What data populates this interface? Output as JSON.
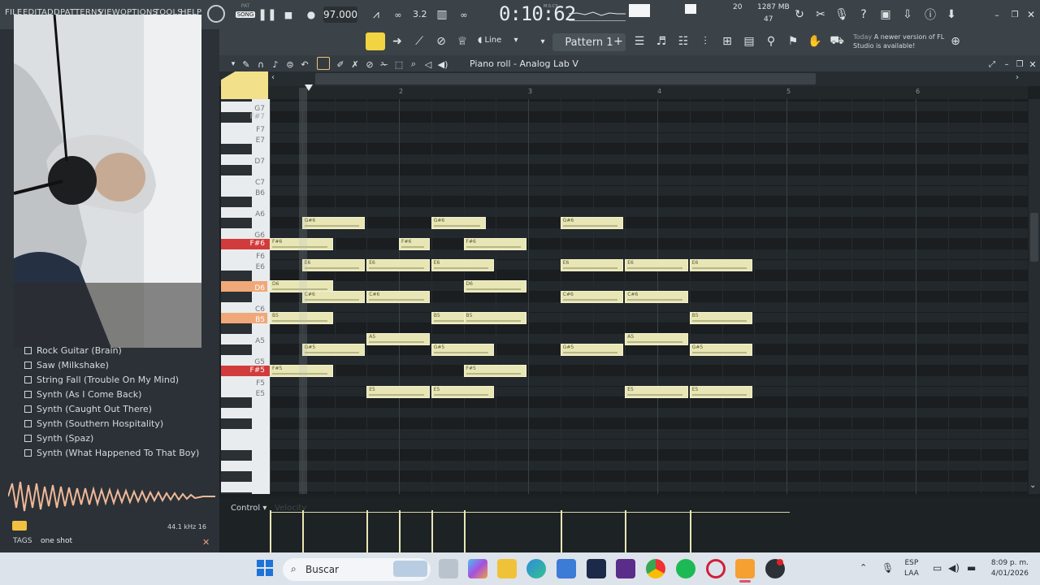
{
  "menu": [
    "FILE",
    "EDIT",
    "ADD",
    "PATTERNS",
    "VIEW",
    "OPTIONS",
    "TOOLS",
    "HELP"
  ],
  "transport": {
    "mode_top": "PAT",
    "mode_bottom": "SONG",
    "tempo": "97.000",
    "time": "0:10:62",
    "time_unit": "M:S:CS",
    "pattern_small": "3.2"
  },
  "stats": {
    "memory": "1287 MB",
    "cpu": "20",
    "polyphony": "47"
  },
  "toolbar": {
    "snap": "Line",
    "pattern": "Pattern 1",
    "news_date": "Today",
    "news_text": "A newer version of FL Studio is available!"
  },
  "piano_roll": {
    "title": "Piano roll - Analog Lab V",
    "bars": [
      "2",
      "3",
      "4",
      "5",
      "6"
    ],
    "keys": [
      "G7",
      "F#7",
      "F7",
      "E7",
      "D7",
      "C7",
      "B6",
      "A6",
      "G6",
      "F#6",
      "F6",
      "E6",
      "D6",
      "C6",
      "B5",
      "A5",
      "G5",
      "F#5",
      "F5",
      "E5"
    ],
    "highlighted_keys": [
      "F#6",
      "D6",
      "B5",
      "F#5"
    ]
  },
  "notes": [
    {
      "p": "G#6",
      "s": 1.5,
      "l": 1
    },
    {
      "p": "G#6",
      "s": 3.5,
      "l": 0.875
    },
    {
      "p": "G#6",
      "s": 5.5,
      "l": 1
    },
    {
      "p": "F#6",
      "s": 1,
      "l": 1
    },
    {
      "p": "F#6",
      "s": 3,
      "l": 0.5
    },
    {
      "p": "F#6",
      "s": 4,
      "l": 1
    },
    {
      "p": "E6",
      "s": 1.5,
      "l": 1
    },
    {
      "p": "E6",
      "s": 2.5,
      "l": 1
    },
    {
      "p": "E6",
      "s": 3.5,
      "l": 1
    },
    {
      "p": "E6",
      "s": 5.5,
      "l": 1
    },
    {
      "p": "E6",
      "s": 6.5,
      "l": 1
    },
    {
      "p": "E6",
      "s": 7.5,
      "l": 1
    },
    {
      "p": "D6",
      "s": 1,
      "l": 1
    },
    {
      "p": "D6",
      "s": 4,
      "l": 1
    },
    {
      "p": "C#6",
      "s": 1.5,
      "l": 1
    },
    {
      "p": "C#6",
      "s": 2.5,
      "l": 1
    },
    {
      "p": "C#6",
      "s": 5.5,
      "l": 1
    },
    {
      "p": "C#6",
      "s": 6.5,
      "l": 1
    },
    {
      "p": "B5",
      "s": 1,
      "l": 1
    },
    {
      "p": "B5",
      "s": 3.5,
      "l": 1
    },
    {
      "p": "B5",
      "s": 4,
      "l": 1
    },
    {
      "p": "B5",
      "s": 7.5,
      "l": 1
    },
    {
      "p": "A5",
      "s": 2.5,
      "l": 1
    },
    {
      "p": "A5",
      "s": 6.5,
      "l": 1
    },
    {
      "p": "G#5",
      "s": 1.5,
      "l": 1
    },
    {
      "p": "G#5",
      "s": 3.5,
      "l": 1
    },
    {
      "p": "G#5",
      "s": 5.5,
      "l": 1
    },
    {
      "p": "G#5",
      "s": 7.5,
      "l": 1
    },
    {
      "p": "F#5",
      "s": 1,
      "l": 1
    },
    {
      "p": "F#5",
      "s": 4,
      "l": 1
    },
    {
      "p": "E5",
      "s": 2.5,
      "l": 1
    },
    {
      "p": "E5",
      "s": 3.5,
      "l": 1
    },
    {
      "p": "E5",
      "s": 6.5,
      "l": 1
    },
    {
      "p": "E5",
      "s": 7.5,
      "l": 1
    }
  ],
  "browser": {
    "items": [
      "Rock Guitar (Brain)",
      "Saw (Milkshake)",
      "String Fall (Trouble On My Mind)",
      "Synth (As I Come Back)",
      "Synth (Caught Out There)",
      "Synth (Southern Hospitality)",
      "Synth (Spaz)",
      "Synth (What Happened To That Boy)"
    ],
    "sample_rate": "44.1 kHz",
    "bits": "16",
    "tags_label": "TAGS",
    "tags_value": "one shot"
  },
  "control": {
    "label": "Control",
    "sublabel": "Velocity"
  },
  "taskbar": {
    "search": "Buscar",
    "lang": "ESP",
    "layout": "LAA",
    "time": "8:09 p. m.",
    "date": "4/01/2026"
  },
  "colors": {
    "note": "#e8e6b4",
    "key_highlight_red": "#d23b3b",
    "key_highlight_orange": "#f0a878"
  }
}
